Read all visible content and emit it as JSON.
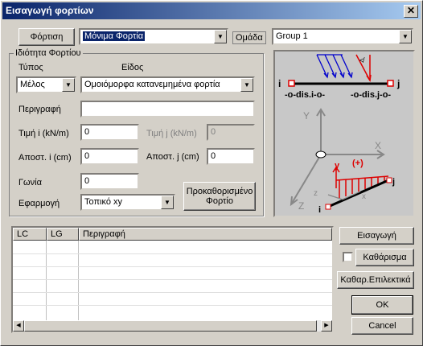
{
  "window": {
    "title": "Εισαγωγή φορτίων",
    "close": "✕"
  },
  "loading": {
    "label": "Φόρτιση",
    "value": "Μόνιμα Φορτία",
    "group_label": "Ομάδα",
    "group_value": "Group 1"
  },
  "props": {
    "title": "Ιδιότητα Φορτίου",
    "type_label": "Τύπος",
    "type_value": "Μέλος",
    "kind_label": "Είδος",
    "kind_value": "Ομοιόμορφα κατανεμημένα φορτία",
    "desc_label": "Περιγραφή",
    "desc_value": "",
    "vi_label": "Τιμή i (kN/m)",
    "vi_value": "0",
    "vj_label": "Τιμή j (kN/m)",
    "vj_value": "0",
    "di_label": "Αποστ. i (cm)",
    "di_value": "0",
    "dj_label": "Αποστ. j (cm)",
    "dj_value": "0",
    "angle_label": "Γωνία",
    "angle_value": "0",
    "apply_label": "Εφαρμογή",
    "apply_value": "Τοπικό xy",
    "predefined_label": "Προκαθορισμένο Φορτίο"
  },
  "diagram": {
    "i": "i",
    "j": "j",
    "dis_i": "-o-dis.i-o-",
    "dis_j": "-o-dis.j-o-",
    "Y": "Y",
    "X": "X",
    "Z": "Z",
    "y": "y",
    "plus": "(+)",
    "x": "x",
    "z": "z",
    "ii": "i",
    "jj": "j"
  },
  "table": {
    "columns": [
      "LC",
      "LG",
      "Περιγραφή"
    ],
    "rows": []
  },
  "buttons": {
    "insert": "Εισαγωγή",
    "clear": "Καθάρισμα",
    "clear_selected": "Καθαρ.Επιλεκτικά",
    "ok": "OK",
    "cancel": "Cancel"
  }
}
